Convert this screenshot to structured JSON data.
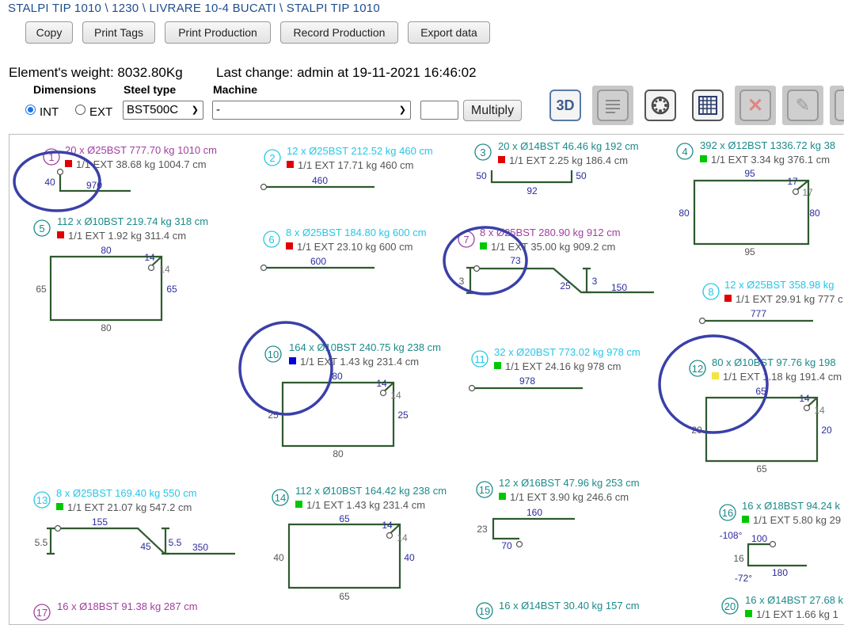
{
  "breadcrumb": "STALPI TIP 1010 \\ 1230 \\ LIVRARE 10-4 BUCATI \\ STALPI TIP 1010",
  "buttons": {
    "copy": "Copy",
    "print_tags": "Print Tags",
    "print_production": "Print Production",
    "record_production": "Record Production",
    "export_data": "Export data"
  },
  "info": {
    "weight": "Element's weight: 8032.80Kg",
    "last_change": "Last change: admin at 19-11-2021 16:46:02"
  },
  "form": {
    "dimensions_label": "Dimensions",
    "steel_type_label": "Steel type",
    "machine_label": "Machine",
    "int_label": "INT",
    "ext_label": "EXT",
    "dimensions_selected": "INT",
    "steel_type_value": "BST500C",
    "machine_value": "-",
    "multiply_value": "",
    "multiply_label": "Multiply"
  },
  "toolbar": {
    "view3d_label": "3D",
    "tools": [
      {
        "icon": "3d-view-icon",
        "enabled": true
      },
      {
        "icon": "document-list-icon",
        "enabled": false
      },
      {
        "icon": "settings-circle-icon",
        "enabled": true
      },
      {
        "icon": "grid-table-icon",
        "enabled": true
      },
      {
        "icon": "delete-x-icon",
        "enabled": false
      },
      {
        "icon": "edit-pencil-icon",
        "enabled": false
      },
      {
        "icon": "more-icon",
        "enabled": false
      }
    ]
  },
  "colors": {
    "shape": "#2f5a2f",
    "dim": "#2c2c9e",
    "teal": "#1c8a8a",
    "cyan": "#27c6e6",
    "purple": "#a03fa0",
    "annotation": "#3a40a8",
    "red": "#e00000",
    "green": "#00c800",
    "blue": "#0000e0",
    "yellow": "#f2e640"
  },
  "bars": [
    {
      "n": "1",
      "title": "20 x Ø25BST 777.70 kg 1010 cm",
      "sub": "1/1 EXT 38.68 kg 1004.7 cm",
      "color": "purple",
      "mark": "red",
      "dims": [
        "40",
        "970"
      ]
    },
    {
      "n": "2",
      "title": "12 x Ø25BST 212.52 kg 460 cm",
      "sub": "1/1 EXT 17.71 kg 460 cm",
      "color": "cyan",
      "mark": "red",
      "dims": [
        "460"
      ]
    },
    {
      "n": "3",
      "title": "20 x Ø14BST 46.46 kg 192 cm",
      "sub": "1/1 EXT 2.25 kg 186.4 cm",
      "color": "teal",
      "mark": "red",
      "dims": [
        "50",
        "92",
        "50"
      ]
    },
    {
      "n": "4",
      "title": "392 x Ø12BST 1336.72 kg 38",
      "sub": "1/1 EXT 3.34 kg 376.1 cm",
      "color": "teal",
      "mark": "green",
      "dims": [
        "95",
        "80",
        "80",
        "95",
        "17",
        "17"
      ]
    },
    {
      "n": "5",
      "title": "112 x Ø10BST 219.74 kg 318 cm",
      "sub": "1/1 EXT 1.92 kg 311.4 cm",
      "color": "teal",
      "mark": "red",
      "dims": [
        "80",
        "65",
        "65",
        "80",
        "14",
        "14"
      ]
    },
    {
      "n": "6",
      "title": "8 x Ø25BST 184.80 kg 600 cm",
      "sub": "1/1 EXT 23.10 kg 600 cm",
      "color": "cyan",
      "mark": "red",
      "dims": [
        "600"
      ]
    },
    {
      "n": "7",
      "title": "8 x Ø25BST 280.90 kg 912 cm",
      "sub": "1/1 EXT 35.00 kg 909.2 cm",
      "color": "purple",
      "mark": "green",
      "dims": [
        "73",
        "3",
        "25",
        "3",
        "150"
      ]
    },
    {
      "n": "8",
      "title": "12 x Ø25BST 358.98 kg",
      "sub": "1/1 EXT 29.91 kg 777 c",
      "color": "cyan",
      "mark": "red",
      "dims": [
        "777"
      ]
    },
    {
      "n": "10",
      "title": "164 x Ø10BST 240.75 kg 238 cm",
      "sub": "1/1 EXT 1.43 kg 231.4 cm",
      "color": "teal",
      "mark": "blue",
      "dims": [
        "80",
        "25",
        "25",
        "80",
        "14",
        "14"
      ]
    },
    {
      "n": "11",
      "title": "32 x Ø20BST 773.02 kg 978 cm",
      "sub": "1/1 EXT 24.16 kg 978 cm",
      "color": "cyan",
      "mark": "green",
      "dims": [
        "978"
      ]
    },
    {
      "n": "12",
      "title": "80 x Ø10BST 97.76 kg 198",
      "sub": "1/1 EXT 1.18 kg 191.4 cm",
      "color": "teal",
      "mark": "yellow",
      "dims": [
        "65",
        "20",
        "20",
        "65",
        "14",
        "14"
      ]
    },
    {
      "n": "13",
      "title": "8 x Ø25BST 169.40 kg 550 cm",
      "sub": "1/1 EXT 21.07 kg 547.2 cm",
      "color": "cyan",
      "mark": "green",
      "dims": [
        "155",
        "5.5",
        "45",
        "5.5",
        "350"
      ]
    },
    {
      "n": "14",
      "title": "112 x Ø10BST 164.42 kg 238 cm",
      "sub": "1/1 EXT 1.43 kg 231.4 cm",
      "color": "teal",
      "mark": "green",
      "dims": [
        "65",
        "40",
        "40",
        "65",
        "14",
        "14"
      ]
    },
    {
      "n": "15",
      "title": "12 x Ø16BST 47.96 kg 253 cm",
      "sub": "1/1 EXT 3.90 kg 246.6 cm",
      "color": "teal",
      "mark": "green",
      "dims": [
        "160",
        "23",
        "70"
      ]
    },
    {
      "n": "16",
      "title": "16 x Ø18BST 94.24 k",
      "sub": "1/1 EXT 5.80 kg 29",
      "color": "teal",
      "mark": "green",
      "dims": [
        "-108°",
        "100",
        "16",
        "-72°",
        "180"
      ]
    },
    {
      "n": "17",
      "title": "16 x Ø18BST 91.38 kg 287 cm",
      "color": "purple"
    },
    {
      "n": "19",
      "title": "16 x Ø14BST 30.40 kg 157 cm",
      "color": "teal"
    },
    {
      "n": "20",
      "title": "16 x Ø14BST 27.68 k",
      "sub": "1/1 EXT 1.66 kg 1",
      "color": "teal",
      "mark": "green"
    }
  ]
}
